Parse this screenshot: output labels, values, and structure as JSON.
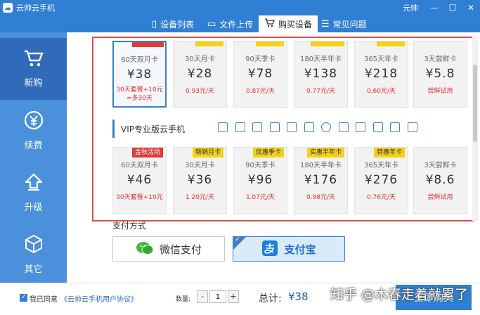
{
  "window": {
    "title": "云帅云手机",
    "user": "元帅",
    "controls": [
      "minimize",
      "maximize",
      "close"
    ]
  },
  "nav": {
    "tabs": [
      {
        "label": "设备列表",
        "icon": "phone-icon",
        "active": false
      },
      {
        "label": "文件上传",
        "icon": "folder-icon",
        "active": false
      },
      {
        "label": "购买设备",
        "icon": "cart-icon",
        "active": true
      },
      {
        "label": "常见问题",
        "icon": "list-icon",
        "active": false
      }
    ]
  },
  "sidebar": {
    "items": [
      {
        "label": "新购",
        "icon": "cart-icon",
        "active": true
      },
      {
        "label": "续费",
        "icon": "yen-circle-icon",
        "active": false
      },
      {
        "label": "升级",
        "icon": "arrow-up-icon",
        "active": false
      },
      {
        "label": "其它",
        "icon": "cube-icon",
        "active": false
      }
    ]
  },
  "plans_standard": [
    {
      "name": "60天双月卡",
      "price": "¥38",
      "per": "30天套餐+10元",
      "per2": "=多30天",
      "badge": "",
      "selected": true
    },
    {
      "name": "30天月卡",
      "price": "¥28",
      "per": "0.93元/天",
      "per2": "",
      "badge": "",
      "selected": false
    },
    {
      "name": "90天季卡",
      "price": "¥78",
      "per": "0.87元/天",
      "per2": "",
      "badge": "",
      "selected": false
    },
    {
      "name": "180天半年卡",
      "price": "¥138",
      "per": "0.77元/天",
      "per2": "",
      "badge": "",
      "selected": false
    },
    {
      "name": "365天年卡",
      "price": "¥218",
      "per": "0.60元/天",
      "per2": "",
      "badge": "",
      "selected": false
    },
    {
      "name": "3天尝鲜卡",
      "price": "¥5.8",
      "per": "尝鲜试用",
      "per2": "",
      "badge": "",
      "selected": false
    }
  ],
  "vip_section": {
    "title": "VIP专业版云手机"
  },
  "plans_vip": [
    {
      "name": "60天双月卡",
      "price": "¥46",
      "per": "30天套餐+10元",
      "badge": "金秋活动",
      "badge_color": "red"
    },
    {
      "name": "30天月卡",
      "price": "¥36",
      "per": "1.20元/天",
      "badge": "畅销月卡",
      "badge_color": "yellow"
    },
    {
      "name": "90天季卡",
      "price": "¥96",
      "per": "1.07元/天",
      "badge": "优惠季卡",
      "badge_color": "yellow"
    },
    {
      "name": "180天半年卡",
      "price": "¥176",
      "per": "0.98元/天",
      "badge": "实惠半年卡",
      "badge_color": "yellow"
    },
    {
      "name": "365天年卡",
      "price": "¥276",
      "per": "0.76元/天",
      "badge": "特惠年卡",
      "badge_color": "yellow"
    },
    {
      "name": "3天尝鲜卡",
      "price": "¥8.6",
      "per": "尝鲜试用",
      "badge": "",
      "badge_color": ""
    }
  ],
  "payment": {
    "label": "支付方式",
    "options": [
      {
        "label": "微信支付",
        "icon": "wechat-icon",
        "selected": false
      },
      {
        "label": "支付宝",
        "icon": "alipay-icon",
        "selected": true
      }
    ]
  },
  "footer": {
    "agree_text": "我已同意",
    "agreement_link": "《云帅云手机用户协议》",
    "qty_label": "数量:",
    "qty_minus": "-",
    "qty_value": "1",
    "qty_plus": "+",
    "total_label": "总计:",
    "total_value": "¥38",
    "buy_label": "立即购买"
  },
  "watermark": "知乎 @木春走着就累了",
  "colors": {
    "brand": "#2f7fd3",
    "sidebar": "#4a90db",
    "highlight": "#e34b4b",
    "price_note": "#d33333",
    "badge_yellow": "#f5d21a",
    "badge_red": "#e03a3a"
  }
}
